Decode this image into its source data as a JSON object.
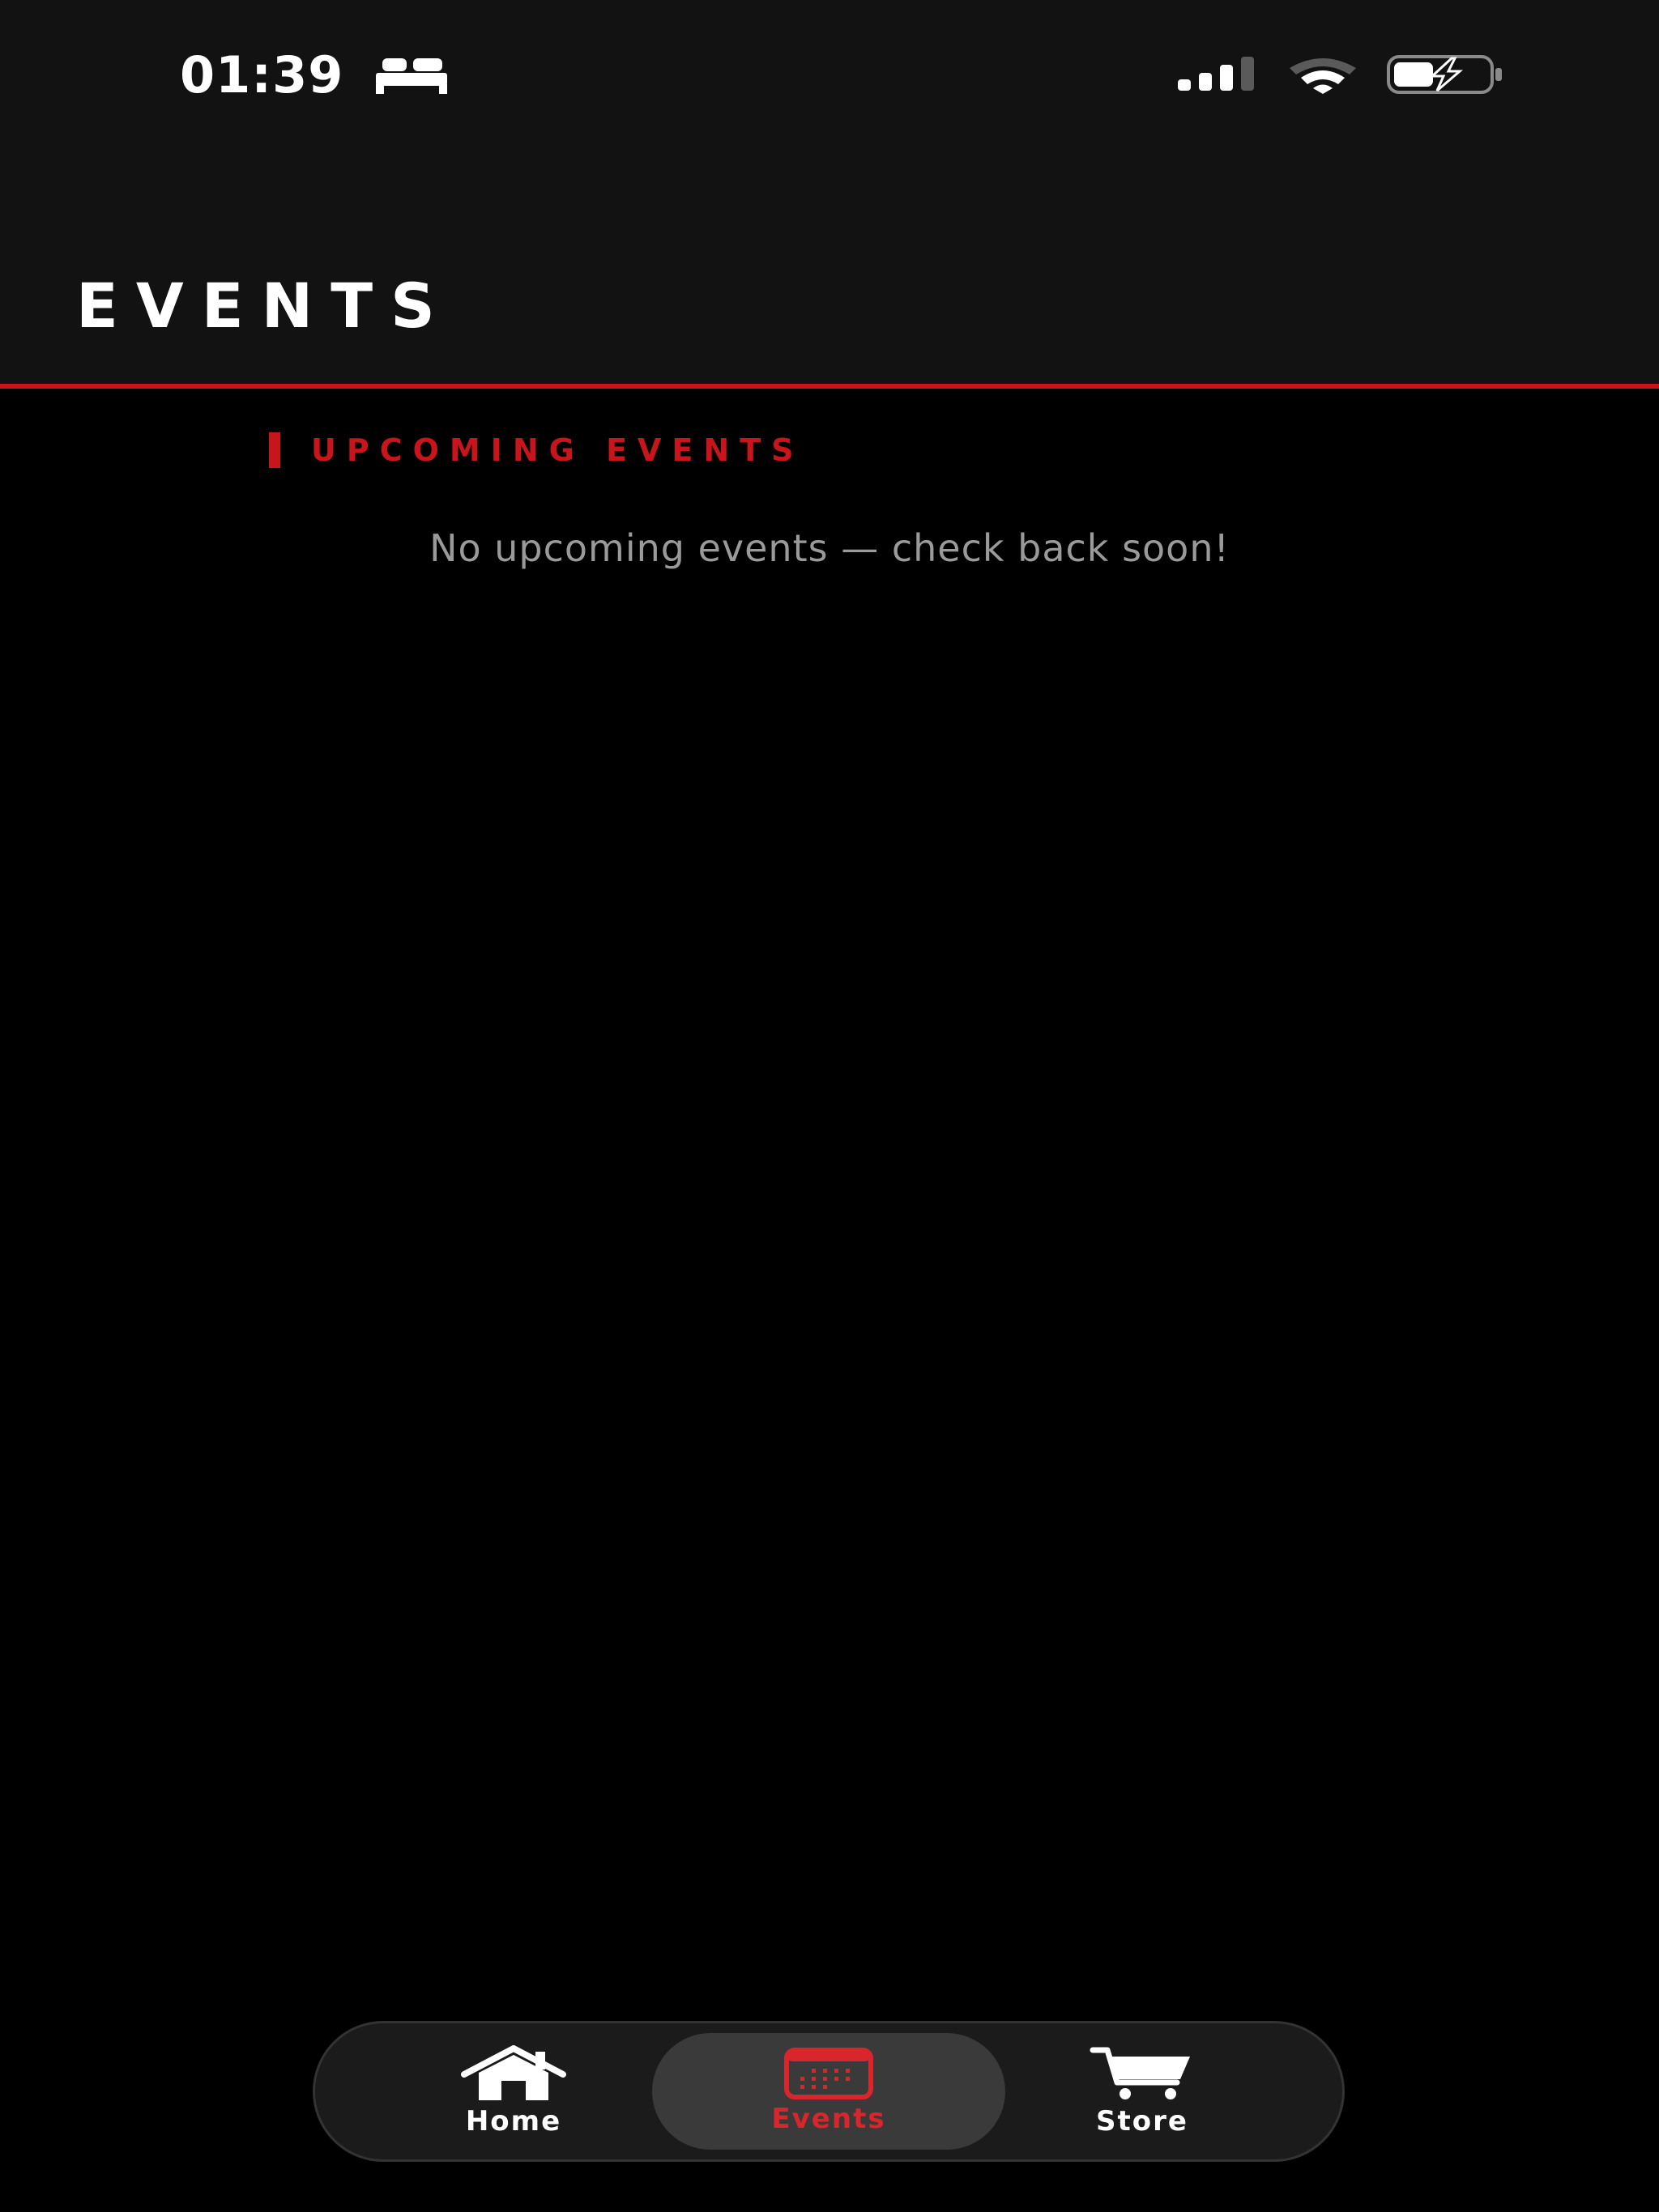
{
  "status_bar": {
    "time": "01:39",
    "focus_icon": "bed-icon",
    "signal_icon": "cellular-signal-icon",
    "wifi_icon": "wifi-icon",
    "battery_icon": "battery-charging-icon"
  },
  "header": {
    "title": "EVENTS"
  },
  "section": {
    "title": "UPCOMING EVENTS",
    "empty_message": "No upcoming events — check back soon!"
  },
  "tab_bar": {
    "tabs": [
      {
        "label": "Home",
        "icon": "home-icon",
        "active": false
      },
      {
        "label": "Events",
        "icon": "calendar-icon",
        "active": true
      },
      {
        "label": "Store",
        "icon": "cart-icon",
        "active": false
      }
    ]
  },
  "colors": {
    "accent": "#c8141b",
    "background": "#000000",
    "header_background": "#121212",
    "muted_text": "#9a9a9a",
    "tab_bar_background": "#1b1b1b",
    "active_tab_background": "#3a3a3a"
  }
}
